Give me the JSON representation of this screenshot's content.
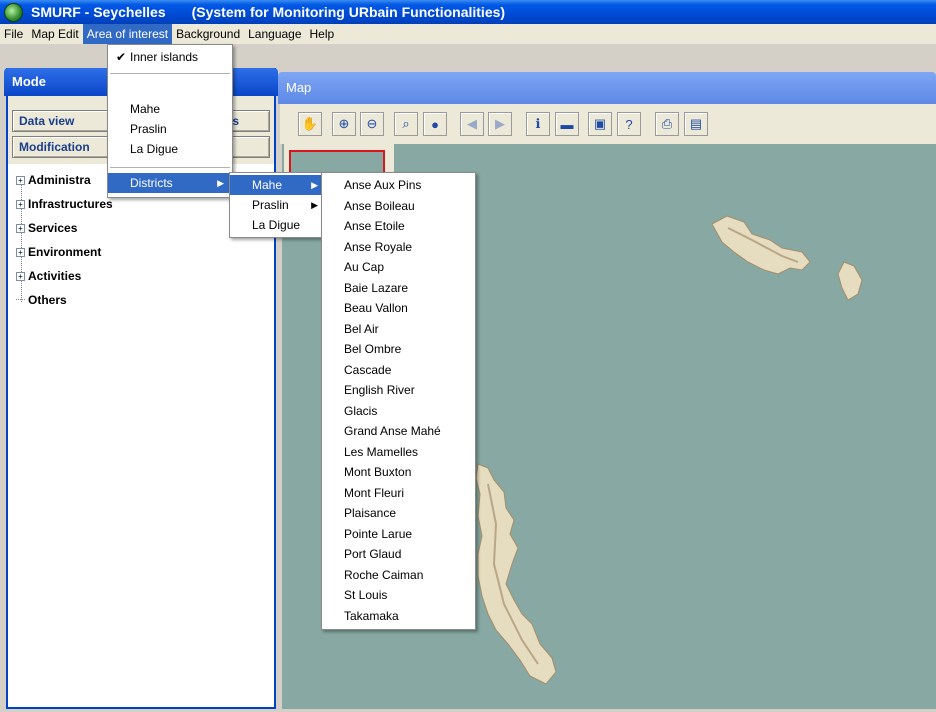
{
  "title": {
    "app": "SMURF - Seychelles",
    "subtitle": "(System for Monitoring URbain Functionalities)",
    "icon": "globe-icon"
  },
  "menubar": [
    "File",
    "Map Edit",
    "Area of interest",
    "Background",
    "Language",
    "Help"
  ],
  "mode_panel": {
    "header": "Mode",
    "buttons": [
      "Data view",
      "Modification"
    ],
    "button_right_fragment": "s",
    "tree": [
      "Administra",
      "Infrastructures",
      "Services",
      "Environment",
      "Activities",
      "Others"
    ]
  },
  "map_panel": {
    "header": "Map",
    "toolbar_icons": [
      "pan-hand-icon",
      "zoom-in-icon",
      "zoom-out-icon",
      "zoom-extent-icon",
      "globe-icon",
      "back-arrow-icon",
      "forward-arrow-icon",
      "info-icon",
      "layer-icon",
      "image-icon",
      "help-icon",
      "print-icon",
      "save-icon"
    ]
  },
  "area_menu": {
    "checked_item": "Inner islands",
    "items": [
      "Mahe",
      "Praslin",
      "La Digue"
    ],
    "submenu_item": "Districts"
  },
  "districts_menu": {
    "items": [
      "Mahe",
      "Praslin",
      "La Digue"
    ]
  },
  "mahe_districts": [
    "Anse Aux Pins",
    "Anse Boileau",
    "Anse Etoile",
    "Anse Royale",
    "Au Cap",
    "Baie Lazare",
    "Beau Vallon",
    "Bel Air",
    "Bel Ombre",
    "Cascade",
    "English River",
    "Glacis",
    "Grand Anse Mahé",
    "Les Mamelles",
    "Mont Buxton",
    "Mont Fleuri",
    "Plaisance",
    "Pointe Larue",
    "Port Glaud",
    "Roche Caiman",
    "St Louis",
    "Takamaka"
  ],
  "colors": {
    "selection": "#316ac5",
    "sea": "#87a8a3",
    "title_bar": "#0058e6",
    "overview_box": "#d8161c"
  }
}
